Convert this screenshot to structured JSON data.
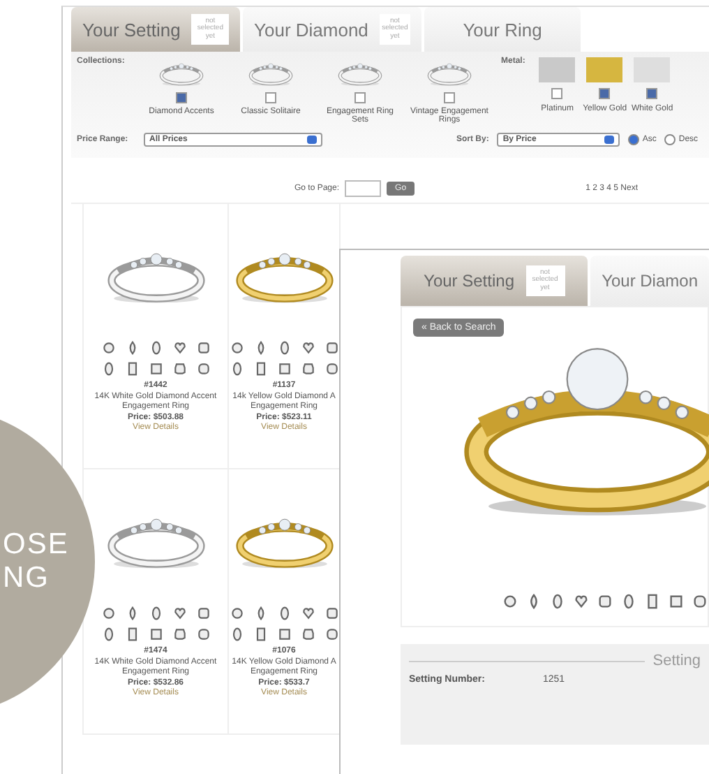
{
  "main_page": {
    "tabs": [
      {
        "label": "Your Setting",
        "badge": "not selected yet",
        "selected": true
      },
      {
        "label": "Your Diamond",
        "badge": "not selected yet",
        "selected": false
      },
      {
        "label": "Your Ring",
        "selected": false
      }
    ],
    "collections": {
      "label": "Collections:",
      "items": [
        {
          "name": "Diamond Accents",
          "checked": true
        },
        {
          "name": "Classic Solitaire",
          "checked": false
        },
        {
          "name": "Engagement Ring Sets",
          "checked": false
        },
        {
          "name": "Vintage Engagement Rings",
          "checked": false
        }
      ]
    },
    "metal": {
      "label": "Metal:",
      "items": [
        {
          "name": "Platinum",
          "color": "#c9c9c9",
          "checked": false
        },
        {
          "name": "Yellow Gold",
          "color": "#d6b640",
          "checked": true
        },
        {
          "name": "White Gold",
          "color": "#dedede",
          "checked": true
        }
      ]
    },
    "price_range": {
      "label": "Price Range:",
      "value": "All Prices"
    },
    "sort_by": {
      "label": "Sort By:",
      "value": "By Price",
      "options": [
        {
          "label": "Asc",
          "selected": true
        },
        {
          "label": "Desc",
          "selected": false
        }
      ]
    },
    "pager": {
      "label": "Go to Page:",
      "button": "Go",
      "pages": "1 2 3 4 5 Next"
    },
    "products": [
      {
        "kind": "white",
        "number": "#1442",
        "title": "14K White Gold Diamond Accent Engagement Ring",
        "price_label": "Price:",
        "price": "$503.88",
        "link": "View Details"
      },
      {
        "kind": "yellow",
        "number": "#1137",
        "title": "14k Yellow Gold Diamond A",
        "title_2": "Engagement Ring",
        "price_label": "Price:",
        "price": "$523.11",
        "link": "View Details"
      },
      {
        "kind": "white",
        "number": "#1474",
        "title": "14K White Gold Diamond Accent Engagement Ring",
        "price_label": "Price:",
        "price": "$532.86",
        "link": "View Details"
      },
      {
        "kind": "yellow",
        "number": "#1076",
        "title": "14K Yellow Gold Diamond A",
        "title_2": "Engagement Ring",
        "price_label": "Price:",
        "price": "$533.7",
        "link": "View Details"
      }
    ]
  },
  "promo_circle": {
    "lines": [
      "OSE",
      "NG"
    ]
  },
  "detail_window": {
    "tabs": [
      {
        "label": "Your Setting",
        "badge": "not selected yet",
        "selected": true
      },
      {
        "label": "Your Diamon",
        "selected": false
      }
    ],
    "back_button": "« Back to Search",
    "panel": {
      "title": "Setting",
      "rows": [
        {
          "label": "Setting Number:",
          "value": "1251"
        }
      ]
    }
  }
}
